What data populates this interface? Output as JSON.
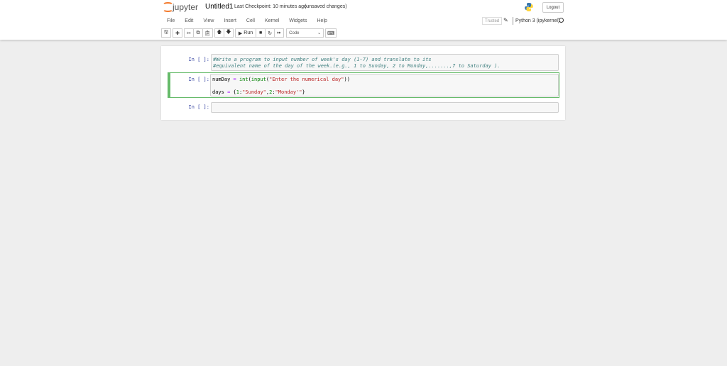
{
  "header": {
    "logo_text": "jupyter",
    "notebook_title": "Untitled1",
    "checkpoint": "Last Checkpoint: 10 minutes ago",
    "unsaved": "(unsaved changes)",
    "logout": "Logout"
  },
  "menu": [
    "File",
    "Edit",
    "View",
    "Insert",
    "Cell",
    "Kernel",
    "Widgets",
    "Help"
  ],
  "status": {
    "trusted": "Trusted",
    "kernel": "Python 3 (ipykernel)"
  },
  "toolbar": {
    "run": "Run",
    "cell_type": "Code"
  },
  "cells": [
    {
      "prompt": "In [ ]:",
      "lines": [
        "#Write a program to input number of week's day (1-7) and translate to its",
        "#equivalent name of the day of the week.(e.g., 1 to Sunday, 2 to Monday,.......,7 to Saturday )."
      ]
    },
    {
      "prompt": "In [ ]:",
      "line1": {
        "a": "numDay ",
        "b": "=",
        "c": " ",
        "d": "int",
        "e": "(",
        "f": "input",
        "g": "(",
        "h": "\"Enter the numerical day\"",
        "i": "))"
      },
      "line3": {
        "a": "days ",
        "b": "=",
        "c": " {",
        "d": "1",
        ":": ":",
        "e": "\"Sunday\"",
        "f": ",",
        "g": "2",
        "h": ":",
        "i": "\"Monday'\"",
        "j": "}"
      }
    },
    {
      "prompt": "In [ ]:"
    }
  ]
}
